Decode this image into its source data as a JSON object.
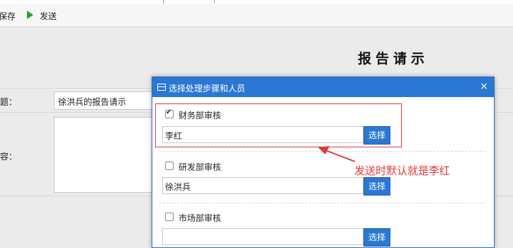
{
  "toolbar": {
    "save_label": "保存",
    "send_label": "发送"
  },
  "document": {
    "title": "报告请示",
    "fields": {
      "subject_label": "标题：",
      "subject_value": "徐洪兵的报告请示",
      "content_label": "内容："
    }
  },
  "dialog": {
    "title": "选择处理步骤和人员",
    "close_label": "×",
    "steps": [
      {
        "label": "财务部审核",
        "checked": true,
        "person": "李红",
        "button": "选择"
      },
      {
        "label": "研发部审核",
        "checked": false,
        "person": "徐洪兵",
        "button": "选择"
      },
      {
        "label": "市场部审核",
        "checked": false,
        "person": "",
        "button": "选择"
      }
    ]
  },
  "annotation": {
    "text": "发送时默认就是李红",
    "color": "#e03a3a"
  },
  "colors": {
    "accent": "#2a78d3",
    "highlight": "#e23b3b"
  }
}
